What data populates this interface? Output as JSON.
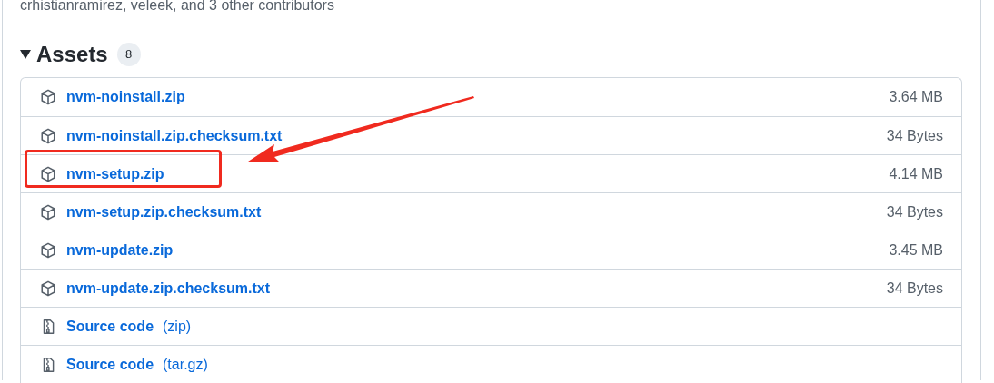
{
  "contributors": "crhistianramirez, veleek, and 3 other contributors",
  "assets": {
    "title": "Assets",
    "count": "8",
    "expanded": true,
    "rows": [
      {
        "kind": "package",
        "name": "nvm-noinstall.zip",
        "size": "3.64 MB",
        "annotated": false
      },
      {
        "kind": "package",
        "name": "nvm-noinstall.zip.checksum.txt",
        "size": "34 Bytes",
        "annotated": false
      },
      {
        "kind": "package",
        "name": "nvm-setup.zip",
        "size": "4.14 MB",
        "annotated": true
      },
      {
        "kind": "package",
        "name": "nvm-setup.zip.checksum.txt",
        "size": "34 Bytes",
        "annotated": false
      },
      {
        "kind": "package",
        "name": "nvm-update.zip",
        "size": "3.45 MB",
        "annotated": false
      },
      {
        "kind": "package",
        "name": "nvm-update.zip.checksum.txt",
        "size": "34 Bytes",
        "annotated": false
      },
      {
        "kind": "source",
        "name": "Source code",
        "format": "(zip)",
        "annotated": false
      },
      {
        "kind": "source",
        "name": "Source code",
        "format": "(tar.gz)",
        "annotated": false
      }
    ]
  }
}
